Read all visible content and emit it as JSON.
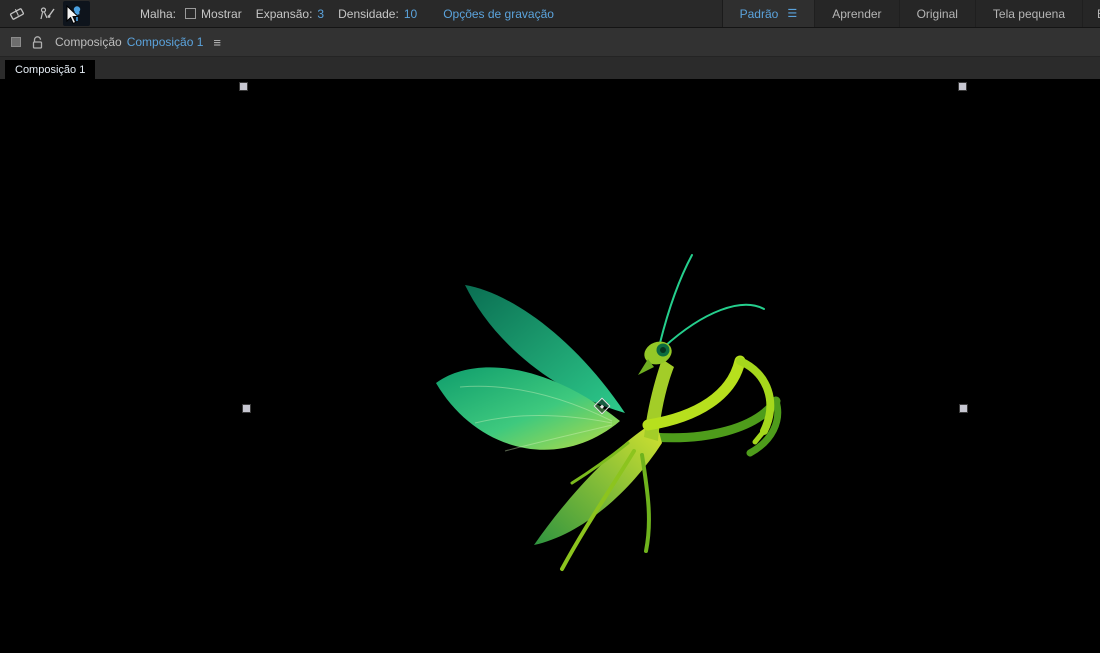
{
  "icons": {
    "workspace_menu": "☰",
    "panel_menu": "≡"
  },
  "toolbar": {
    "tools": [
      {
        "id": "eraser",
        "selected": false
      },
      {
        "id": "roto-brush",
        "selected": false
      },
      {
        "id": "puppet-pin",
        "selected": true
      }
    ],
    "malha_label": "Malha:",
    "mostrar_label": "Mostrar",
    "mostrar_checked": false,
    "expansao_label": "Expansão:",
    "expansao_value": "3",
    "densidade_label": "Densidade:",
    "densidade_value": "10",
    "record_options_link": "Opções de gravação",
    "workspaces": {
      "items": [
        {
          "label": "Padrão",
          "active": true
        },
        {
          "label": "Aprender",
          "active": false
        },
        {
          "label": "Original",
          "active": false
        },
        {
          "label": "Tela pequena",
          "active": false
        },
        {
          "label": "B",
          "active": false,
          "truncated": true
        }
      ]
    }
  },
  "composition_panel": {
    "panel_label": "Composição",
    "composition_name": "Composição 1",
    "viewer_tab_label": "Composição 1"
  },
  "viewer": {
    "artwork": "green-praying-mantis-illustration",
    "selection_handle_color": "#c7c7d1",
    "puppet_pin_overlay": true
  },
  "colors": {
    "accent_blue": "#5ba3dc",
    "toolbar_bg": "#292929",
    "panel_header_bg": "#323232",
    "tab_row_bg": "#2b2b2b",
    "active_tab_bg": "#000000",
    "viewer_bg": "#000000",
    "text": "#c6c6c6",
    "mantis_teal": "#2ecb8b",
    "mantis_dark_green": "#4e9c1b",
    "mantis_yellow_green": "#b7e01d"
  }
}
